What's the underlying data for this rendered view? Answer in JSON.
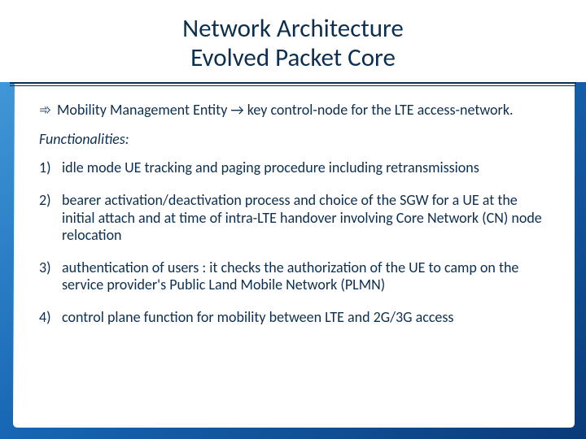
{
  "title": {
    "line1": "Network Architecture",
    "line2": "Evolved Packet Core"
  },
  "intro": {
    "bullet": "➾",
    "text": "Mobility Management Entity → key control-node for the LTE access-network."
  },
  "functionalities_label": "Functionalities:",
  "items": [
    {
      "num": "1)",
      "text": "idle mode UE tracking and paging procedure including retransmissions"
    },
    {
      "num": "2)",
      "text": "bearer activation/deactivation process and choice of the SGW for a UE at the initial attach and at time of intra-LTE handover involving Core Network (CN) node relocation"
    },
    {
      "num": "3)",
      "text": "authentication of users : it checks the authorization of the UE to camp on the service provider's Public Land Mobile Network (PLMN)"
    },
    {
      "num": "4)",
      "text": "control plane function for mobility between LTE and 2G/3G access"
    }
  ]
}
